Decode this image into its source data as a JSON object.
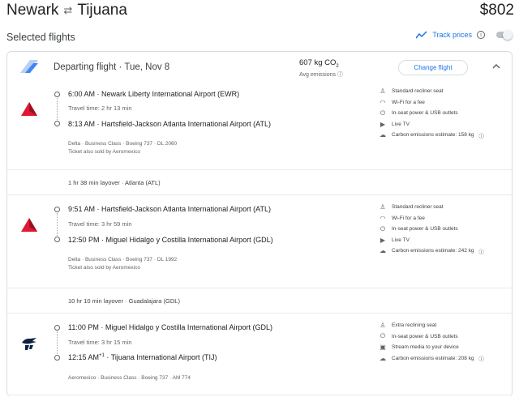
{
  "header": {
    "origin": "Newark",
    "destination": "Tijuana",
    "swap_icon": "swap-arrows-icon",
    "price": "$802"
  },
  "selected_flights_label": "Selected flights",
  "track_prices": {
    "label": "Track prices",
    "enabled": false
  },
  "departing": {
    "title": "Departing flight",
    "date": "Tue, Nov 8",
    "emissions_value": "607 kg CO",
    "emissions_sub": "2",
    "emissions_caption": "Avg emissions",
    "change_button": "Change flight"
  },
  "segments": [
    {
      "airline_color": "#E01933",
      "dep_time": "6:00 AM",
      "dep_airport": "Newark Liberty International Airport (EWR)",
      "travel_time": "Travel time: 2 hr 13 min",
      "arr_time": "8:13 AM",
      "arr_airport": "Hartsfield-Jackson Atlanta International Airport (ATL)",
      "details": "Delta · Business Class · Boeing 737 · DL 2060",
      "also_sold": "Ticket also sold by Aeromexico",
      "amenities": [
        {
          "icon": "seat-icon",
          "glyph": "♩",
          "text": "Standard recliner seat"
        },
        {
          "icon": "wifi-icon",
          "glyph": "◠",
          "text": "Wi-Fi for a fee"
        },
        {
          "icon": "power-icon",
          "glyph": "⏻",
          "text": "In-seat power & USB outlets"
        },
        {
          "icon": "tv-icon",
          "glyph": "▶",
          "text": "Live TV"
        },
        {
          "icon": "co2-icon",
          "glyph": "☁",
          "text": "Carbon emissions estimate: 158 kg"
        }
      ]
    },
    {
      "airline_color": "#E01933",
      "dep_time": "9:51 AM",
      "dep_airport": "Hartsfield-Jackson Atlanta International Airport (ATL)",
      "travel_time": "Travel time: 3 hr 59 min",
      "arr_time": "12:50 PM",
      "arr_airport": "Miguel Hidalgo y Costilla International Airport (GDL)",
      "details": "Delta · Business Class · Boeing 737 · DL 1992",
      "also_sold": "Ticket also sold by Aeromexico",
      "amenities": [
        {
          "icon": "seat-icon",
          "glyph": "♩",
          "text": "Standard recliner seat"
        },
        {
          "icon": "wifi-icon",
          "glyph": "◠",
          "text": "Wi-Fi for a fee"
        },
        {
          "icon": "power-icon",
          "glyph": "⏻",
          "text": "In-seat power & USB outlets"
        },
        {
          "icon": "tv-icon",
          "glyph": "▶",
          "text": "Live TV"
        },
        {
          "icon": "co2-icon",
          "glyph": "☁",
          "text": "Carbon emissions estimate: 242 kg"
        }
      ]
    },
    {
      "airline_color": "#0B2343",
      "dep_time": "11:00 PM",
      "dep_airport": "Miguel Hidalgo y Costilla International Airport (GDL)",
      "travel_time": "Travel time: 3 hr 15 min",
      "arr_time": "12:15 AM",
      "arr_sup": "+1",
      "arr_airport": "Tijuana International Airport (TIJ)",
      "details": "Aeromexico · Business Class · Boeing 737 · AM 774",
      "amenities": [
        {
          "icon": "seat-icon",
          "glyph": "♩",
          "text": "Extra reclining seat"
        },
        {
          "icon": "power-icon",
          "glyph": "⏻",
          "text": "In-seat power & USB outlets"
        },
        {
          "icon": "stream-icon",
          "glyph": "▣",
          "text": "Stream media to your device"
        },
        {
          "icon": "co2-icon",
          "glyph": "☁",
          "text": "Carbon emissions estimate: 208 kg"
        }
      ]
    }
  ],
  "layovers": [
    "1 hr 38 min layover · Atlanta (ATL)",
    "10 hr 10 min layover · Guadalajara (GDL)"
  ]
}
